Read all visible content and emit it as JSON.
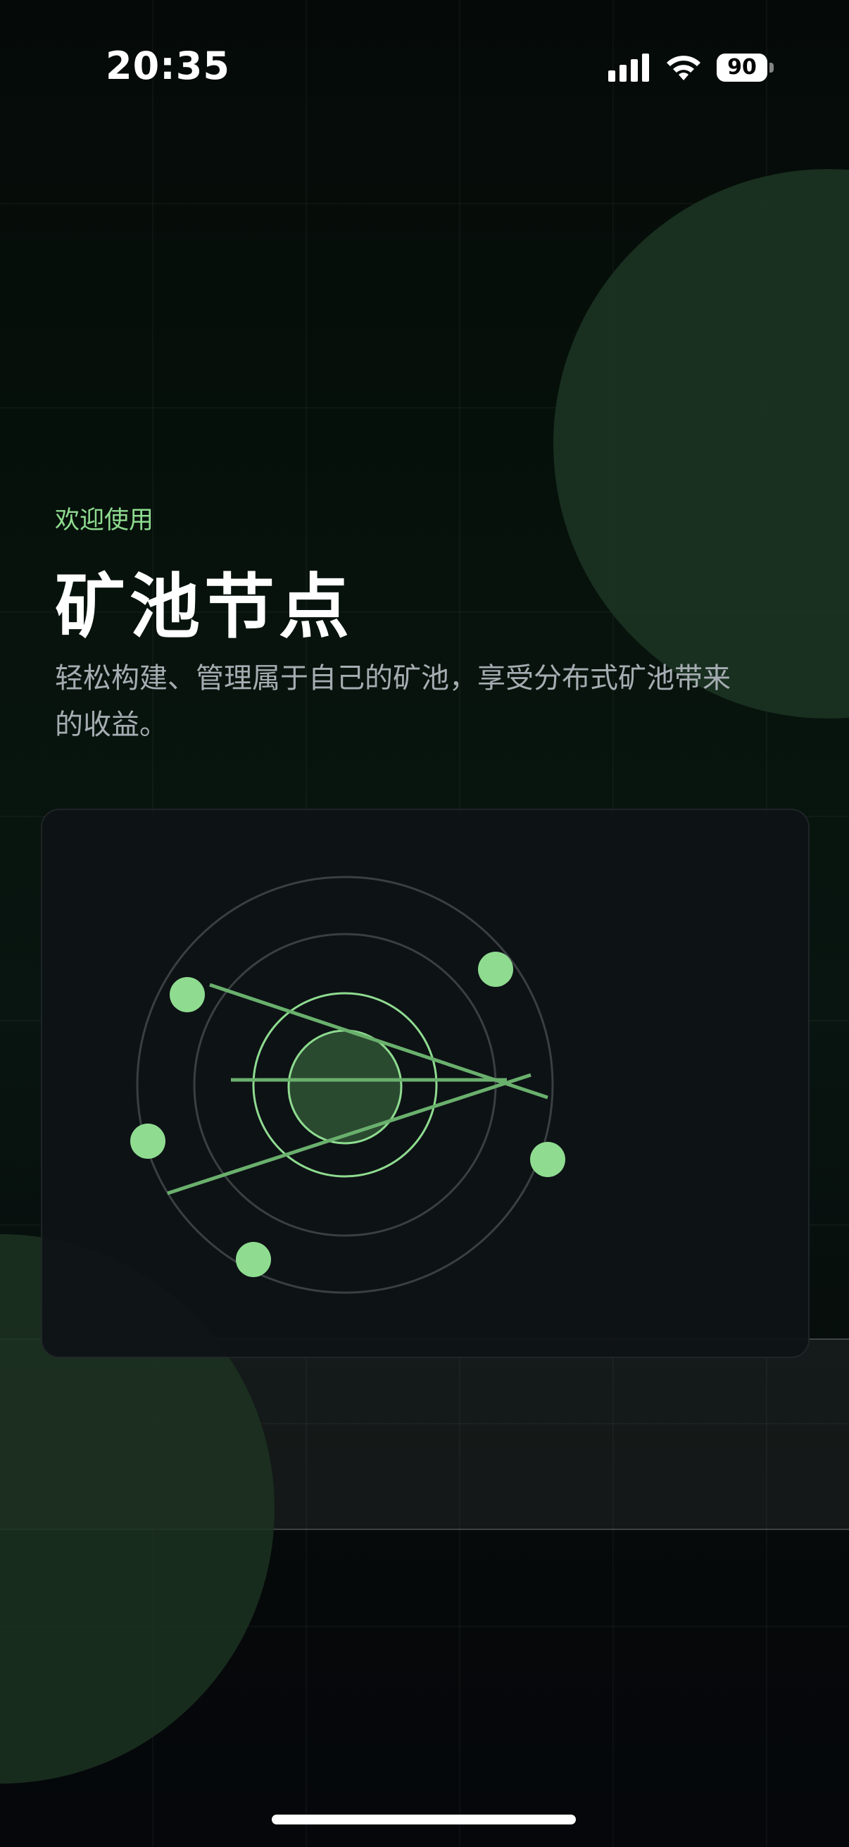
{
  "status_bar": {
    "time": "20:35",
    "battery": "90",
    "icons": [
      "signal-icon",
      "wifi-icon",
      "battery-icon"
    ]
  },
  "hero": {
    "welcome": "欢迎使用",
    "title": "矿池节点",
    "subtitle": "轻松构建、管理属于自己的矿池，享受分布式矿池带来的收益。"
  },
  "colors": {
    "accent": "#8fdc90",
    "background": "#05080a",
    "blob": "#1c3322",
    "card": "#0e1216",
    "subtitle": "#a6adb2"
  },
  "illustration": {
    "icon": "mining-pool-network-icon",
    "node_count": 5
  }
}
